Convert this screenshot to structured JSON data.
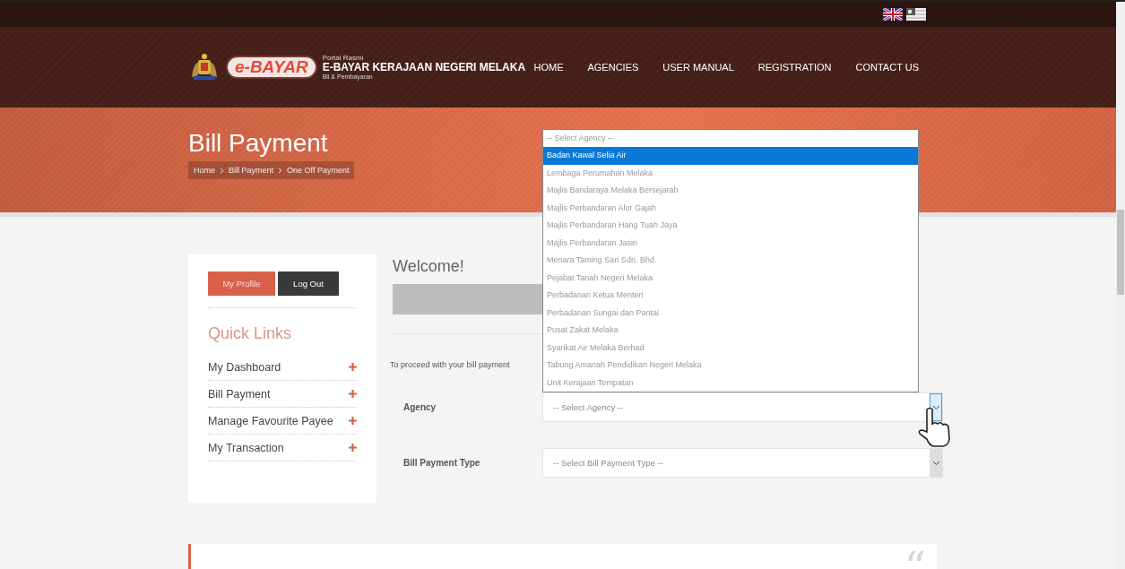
{
  "header": {
    "logo_text": "e-BAYAR",
    "portal_label": "Portal Rasmi",
    "portal_title": "E-BAYAR KERAJAAN NEGERI MELAKA",
    "portal_subtitle": "Bil & Pembayaran",
    "nav": [
      {
        "label": "HOME"
      },
      {
        "label": "AGENCIES"
      },
      {
        "label": "USER MANUAL"
      },
      {
        "label": "REGISTRATION"
      },
      {
        "label": "CONTACT US"
      }
    ]
  },
  "banner": {
    "title": "Bill Payment",
    "breadcrumb": [
      "Home",
      "Bill Payment",
      "One Off Payment"
    ]
  },
  "sidebar": {
    "buttons": [
      {
        "label": "My Profile",
        "kind": "primary"
      },
      {
        "label": "Log Out",
        "kind": "dark"
      }
    ],
    "heading": "Quick Links",
    "links": [
      {
        "label": "My Dashboard"
      },
      {
        "label": "Bill Payment"
      },
      {
        "label": "Manage Favourite Payee"
      },
      {
        "label": "My Transaction"
      }
    ]
  },
  "main": {
    "welcome": "Welcome!",
    "instruction": "To proceed with your bill payment",
    "fields": [
      {
        "label": "Agency",
        "placeholder": "-- Select Agency --",
        "expanded": true
      },
      {
        "label": "Bill Payment Type",
        "placeholder": "-- Select Bill Payment Type --",
        "expanded": false
      }
    ],
    "agency_options": [
      {
        "label": "-- Select Agency --",
        "selected": false
      },
      {
        "label": "Badan Kawal Selia Air",
        "selected": true
      },
      {
        "label": "Lembaga Perumahan Melaka",
        "selected": false
      },
      {
        "label": "Majlis Bandaraya Melaka Bersejarah",
        "selected": false
      },
      {
        "label": "Majlis Perbandaran Alor Gajah",
        "selected": false
      },
      {
        "label": "Majlis Perbandaran Hang Tuah Jaya",
        "selected": false
      },
      {
        "label": "Majlis Perbandaran Jasin",
        "selected": false
      },
      {
        "label": "Menara Taming Sari Sdn. Bhd.",
        "selected": false
      },
      {
        "label": "Pejabat Tanah Negeri Melaka",
        "selected": false
      },
      {
        "label": "Perbadanan Ketua Menteri",
        "selected": false
      },
      {
        "label": "Perbadanan Sungai dan Pantai",
        "selected": false
      },
      {
        "label": "Pusat Zakat Melaka",
        "selected": false
      },
      {
        "label": "Syarikat Air Melaka Berhad",
        "selected": false
      },
      {
        "label": "Tabung Amanah Pendidikan Negeri Melaka",
        "selected": false
      },
      {
        "label": "Unit Kerajaan Tempatan",
        "selected": false
      }
    ]
  },
  "testimonial": {
    "quote_mark": "“"
  }
}
